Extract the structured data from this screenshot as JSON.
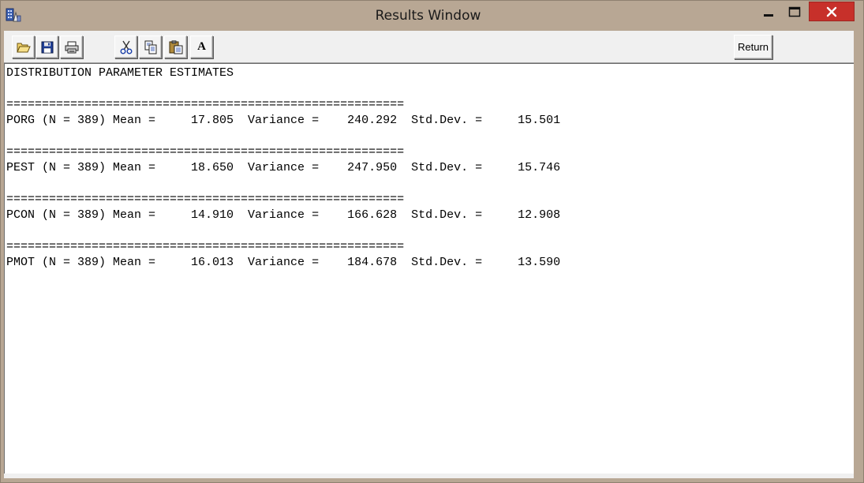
{
  "window": {
    "title": "Results Window",
    "minimize_glyph": "—",
    "maximize_glyph": "☐",
    "close_glyph": "✕",
    "close_color": "#c7302a"
  },
  "toolbar": {
    "buttons": [
      {
        "name": "open-button",
        "icon": "folder-open-icon"
      },
      {
        "name": "save-button",
        "icon": "floppy-disk-icon"
      },
      {
        "name": "print-button",
        "icon": "printer-icon"
      },
      {
        "name": "cut-button",
        "icon": "scissors-icon"
      },
      {
        "name": "copy-button",
        "icon": "copy-icon"
      },
      {
        "name": "paste-button",
        "icon": "paste-icon"
      },
      {
        "name": "font-button",
        "icon": "font-a-icon",
        "label": "A"
      }
    ],
    "return_label": "Return"
  },
  "results": {
    "lines": [
      "DISTRIBUTION PARAMETER ESTIMATES",
      "",
      "========================================================",
      "PORG (N = 389) Mean =     17.805  Variance =    240.292  Std.Dev. =     15.501",
      "",
      "========================================================",
      "PEST (N = 389) Mean =     18.650  Variance =    247.950  Std.Dev. =     15.746",
      "",
      "========================================================",
      "PCON (N = 389) Mean =     14.910  Variance =    166.628  Std.Dev. =     12.908",
      "",
      "========================================================",
      "PMOT (N = 389) Mean =     16.013  Variance =    184.678  Std.Dev. =     13.590"
    ]
  }
}
